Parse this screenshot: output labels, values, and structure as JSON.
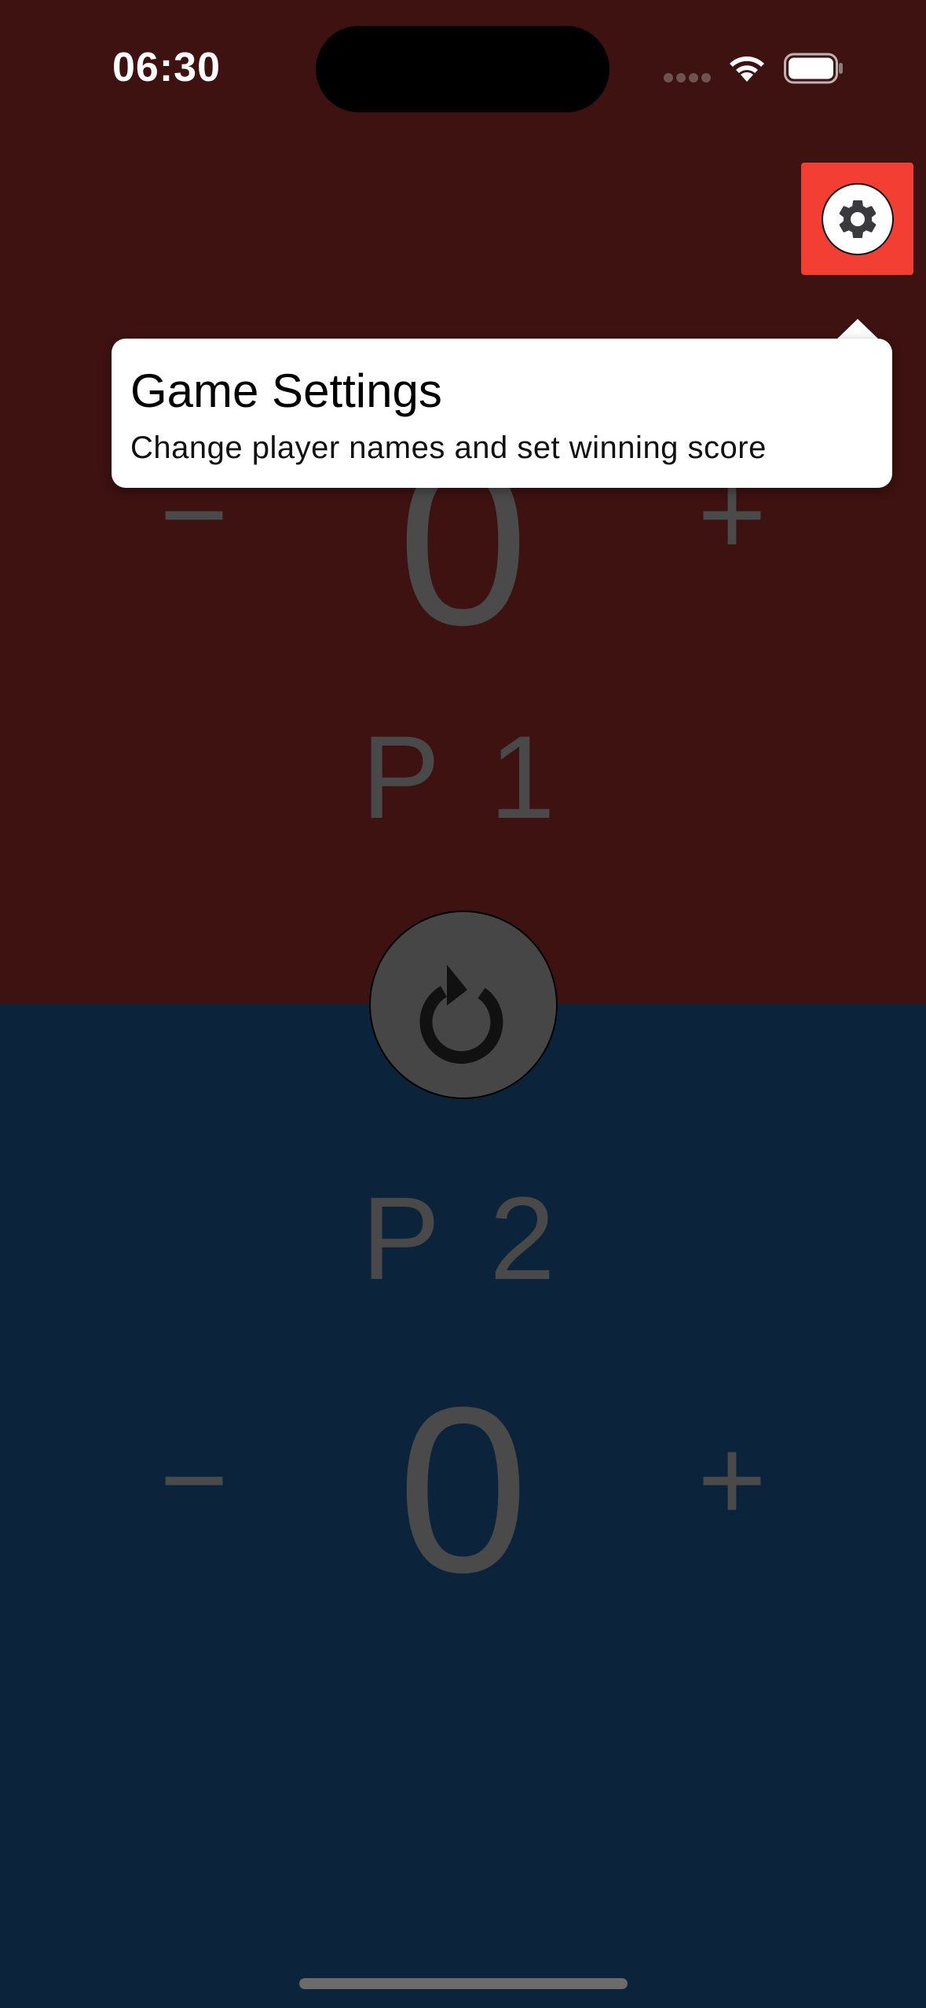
{
  "status_bar": {
    "time": "06:30",
    "icons": [
      "cellular-icon",
      "wifi-icon",
      "battery-icon"
    ]
  },
  "settings_button": {
    "icon": "gear-icon",
    "color": "#f33e33"
  },
  "tooltip": {
    "title": "Game Settings",
    "subtitle": "Change player names and set winning score"
  },
  "players": [
    {
      "name": "P 1",
      "score": "0",
      "minus_label": "−",
      "plus_label": "+",
      "background": "#3d1211"
    },
    {
      "name": "P 2",
      "score": "0",
      "minus_label": "−",
      "plus_label": "+",
      "background": "#0b233b"
    }
  ],
  "reset_button": {
    "icon": "reset-icon"
  }
}
